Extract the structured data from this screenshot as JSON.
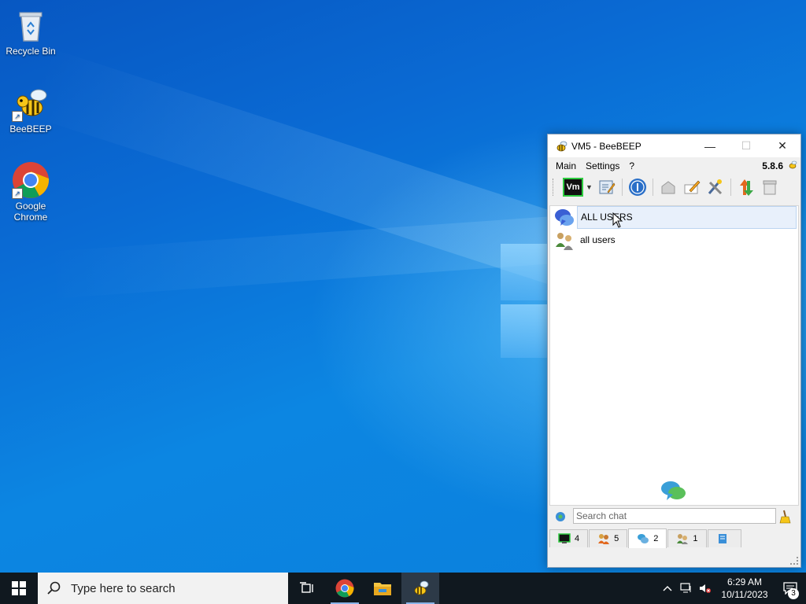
{
  "desktop": {
    "icons": [
      {
        "label": "Recycle Bin"
      },
      {
        "label": "BeeBEEP"
      },
      {
        "label": "Google Chrome"
      }
    ]
  },
  "window": {
    "title": "VM5 - BeeBEEP",
    "controls": {
      "minimize": "—",
      "maximize": "☐",
      "close": "✕"
    },
    "menu": [
      "Main",
      "Settings",
      "?"
    ],
    "version": "5.8.6",
    "toolbar_status_label": "Vm",
    "chats": [
      {
        "label": "ALL USERS",
        "selected": true
      },
      {
        "label": "all users",
        "selected": false
      }
    ],
    "search_placeholder": "Search chat",
    "tabs": [
      {
        "count": "4",
        "icon": "monitor-icon"
      },
      {
        "count": "5",
        "icon": "users-icon"
      },
      {
        "count": "2",
        "icon": "chat-icon",
        "active": true
      },
      {
        "count": "1",
        "icon": "group-icon"
      },
      {
        "count": "",
        "icon": "file-share-icon"
      }
    ]
  },
  "taskbar": {
    "search_placeholder": "Type here to search",
    "time": "6:29 AM",
    "date": "10/11/2023",
    "notification_count": "3"
  },
  "colors": {
    "desktop": "#0a78d7",
    "taskbar": "#10181f",
    "selection": "#e8f0fb"
  }
}
